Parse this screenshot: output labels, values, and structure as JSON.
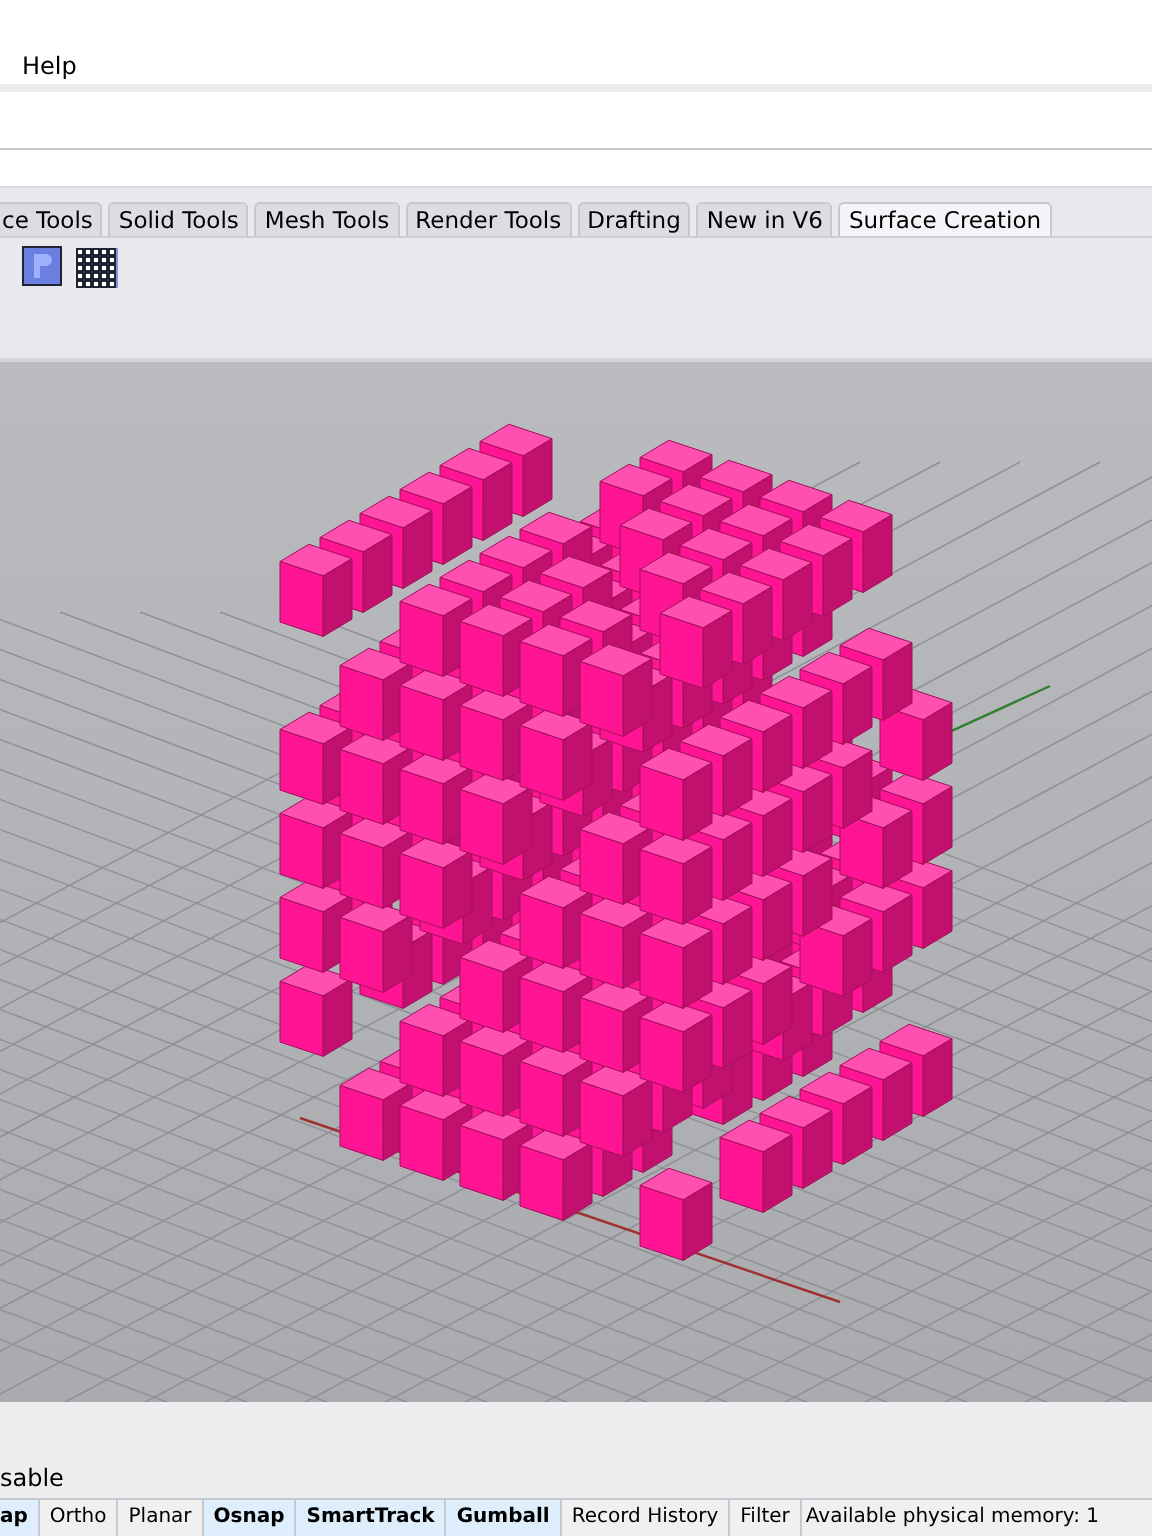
{
  "menu": [
    {
      "label": "Help"
    }
  ],
  "tabs": [
    {
      "label": "ce Tools",
      "selected": false
    },
    {
      "label": "Solid Tools",
      "selected": false
    },
    {
      "label": "Mesh Tools",
      "selected": false
    },
    {
      "label": "Render Tools",
      "selected": false
    },
    {
      "label": "Drafting",
      "selected": false
    },
    {
      "label": "New in V6",
      "selected": false
    },
    {
      "label": "Surface Creation",
      "selected": true
    }
  ],
  "command_history": "sable",
  "status_bar": {
    "toggles": [
      {
        "label": "ap",
        "on": true
      },
      {
        "label": "Ortho",
        "on": false
      },
      {
        "label": "Planar",
        "on": false
      },
      {
        "label": "Osnap",
        "on": true
      },
      {
        "label": "SmartTrack",
        "on": true
      },
      {
        "label": "Gumball",
        "on": true
      },
      {
        "label": "Record History",
        "on": false
      },
      {
        "label": "Filter",
        "on": false
      }
    ],
    "memory": "Available physical memory: 1"
  }
}
